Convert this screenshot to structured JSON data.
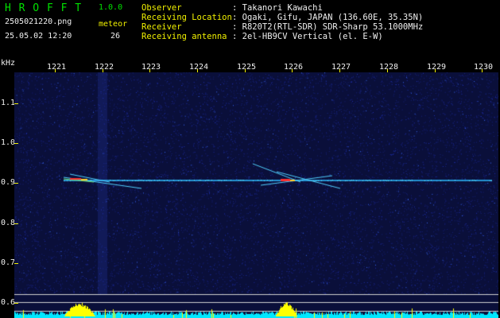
{
  "header": {
    "app_name": "H R O F F T",
    "version": "1.0.0",
    "filename": "2505021220.png",
    "timestamp": "25.05.02 12:20",
    "meteor_label": "meteor",
    "meteor_count": "26"
  },
  "info": [
    {
      "label": "Observer",
      "value": ": Takanori Kawachi"
    },
    {
      "label": "Receiving Location",
      "value": ": Ogaki, Gifu, JAPAN (136.60E, 35.35N)"
    },
    {
      "label": "Receiver",
      "value": ": R820T2(RTL-SDR) SDR-Sharp 53.1000MHz"
    },
    {
      "label": "Receiving antenna",
      "value": ": 2el-HB9CV Vertical (el. E-W)"
    }
  ],
  "axis": {
    "y_unit": "kHz",
    "x_ticks": [
      "1221",
      "1222",
      "1223",
      "1224",
      "1225",
      "1226",
      "1227",
      "1228",
      "1229",
      "1230"
    ],
    "y_ticks": [
      "1.1",
      "1.0",
      "0.9",
      "0.8",
      "0.7",
      "0.6"
    ]
  },
  "colors": {
    "background": "#000000",
    "title_green": "#00e000",
    "axis_yellow": "#f0f000",
    "noise_blue": "#1a2a9a",
    "signal_cyan": "#40e0ff",
    "hot_red": "#ff3030",
    "spectrum_cyan": "#00e8ff",
    "spectrum_yellow": "#ffff00"
  }
}
